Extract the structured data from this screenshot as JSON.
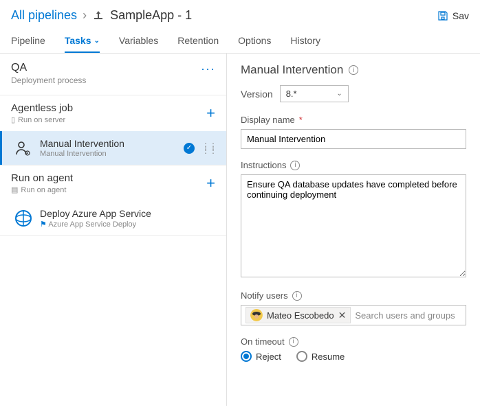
{
  "breadcrumb": {
    "root": "All pipelines",
    "title": "SampleApp - 1"
  },
  "save_label": "Sav",
  "tabs": [
    "Pipeline",
    "Tasks",
    "Variables",
    "Retention",
    "Options",
    "History"
  ],
  "stage": {
    "name": "QA",
    "sub": "Deployment process"
  },
  "jobs": {
    "agentless": {
      "title": "Agentless job",
      "sub": "Run on server"
    },
    "agent": {
      "title": "Run on agent",
      "sub": "Run on agent"
    }
  },
  "tasks": {
    "manual": {
      "title": "Manual Intervention",
      "sub": "Manual Intervention"
    },
    "deploy": {
      "title": "Deploy Azure App Service",
      "sub": "Azure App Service Deploy"
    }
  },
  "panel": {
    "title": "Manual Intervention",
    "version_label": "Version",
    "version_value": "8.*",
    "display_name_label": "Display name",
    "display_name_value": "Manual Intervention",
    "instructions_label": "Instructions",
    "instructions_value": "Ensure QA database updates have completed before continuing deployment",
    "notify_label": "Notify users",
    "user_name": "Mateo Escobedo",
    "search_placeholder": "Search users and groups",
    "timeout_label": "On timeout",
    "reject": "Reject",
    "resume": "Resume"
  }
}
